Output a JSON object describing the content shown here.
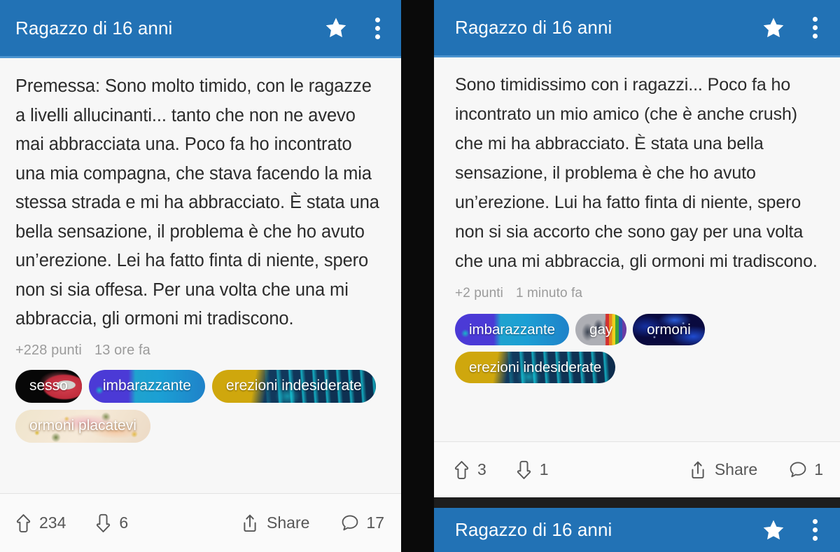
{
  "app": {
    "accent_blue": "#2272b5",
    "accent_blue_line": "#4a93cf",
    "card_bg": "#f7f7f7",
    "divider_black": "#0a0a0a",
    "text_color": "#2b2b2b",
    "meta_color": "#9b9b9b"
  },
  "left_card": {
    "header": {
      "title": "Ragazzo di 16 anni",
      "star_icon": "star-icon",
      "overflow_icon": "more-vertical-icon"
    },
    "post_text": "Premessa: Sono molto timido, con le ragazze a livelli allucinanti... tanto che non ne avevo mai abbracciata una. Poco fa ho incontrato una mia compagna, che stava facendo la mia stessa strada e mi ha abbracciato. È stata una bella sensazione, il problema è che ho avuto un’erezione. Lei ha fatto finta di niente, spero non si sia offesa. Per una volta che una mi abbraccia, gli ormoni mi tradiscono.",
    "meta": {
      "points": "+228 punti",
      "time": "13 ore fa"
    },
    "tags": [
      {
        "label": "sesso",
        "art": "art-sesso"
      },
      {
        "label": "imbarazzante",
        "art": "art-imbara"
      },
      {
        "label": "erezioni indesiderate",
        "art": "art-erezioni"
      },
      {
        "label": "ormoni placatevi",
        "art": "art-placatevi"
      }
    ],
    "actions": {
      "upvote_count": "234",
      "downvote_count": "6",
      "share_label": "Share",
      "comment_count": "17",
      "upvote_icon": "arrow-up-icon",
      "downvote_icon": "arrow-down-icon",
      "share_icon": "share-icon",
      "comment_icon": "comment-bubble-icon"
    }
  },
  "right_card": {
    "header": {
      "title": "Ragazzo di 16 anni",
      "star_icon": "star-icon",
      "overflow_icon": "more-vertical-icon"
    },
    "post_text": "Sono timidissimo con i ragazzi... Poco fa ho incontrato un mio amico (che è anche crush) che mi ha abbracciato. È stata una bella sensazione, il problema è che ho avuto un’erezione. Lui ha fatto finta di niente, spero non si sia accorto che sono gay per una volta che una mi abbraccia, gli ormoni mi tradiscono.",
    "meta": {
      "points": "+2 punti",
      "time": "1 minuto fa"
    },
    "tags": [
      {
        "label": "imbarazzante",
        "art": "art-imbara"
      },
      {
        "label": "gay",
        "art": "art-gay"
      },
      {
        "label": "ormoni",
        "art": "art-ormoni"
      },
      {
        "label": "erezioni indesiderate",
        "art": "art-erezioni"
      }
    ],
    "actions": {
      "upvote_count": "3",
      "downvote_count": "1",
      "share_label": "Share",
      "comment_count": "1",
      "upvote_icon": "arrow-up-icon",
      "downvote_icon": "arrow-down-icon",
      "share_icon": "share-icon",
      "comment_icon": "comment-bubble-icon"
    }
  },
  "right_card_next": {
    "header": {
      "title": "Ragazzo di 16 anni",
      "star_icon": "star-icon",
      "overflow_icon": "more-vertical-icon"
    }
  }
}
